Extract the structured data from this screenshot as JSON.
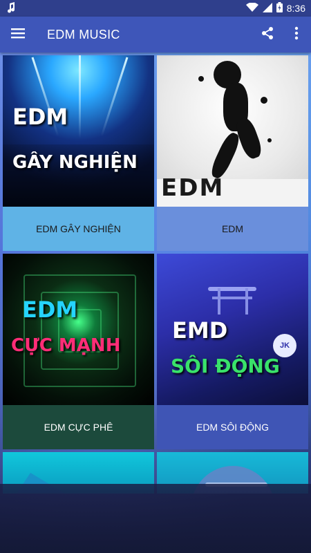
{
  "status": {
    "time": "8:36",
    "icons": [
      "music-note-icon",
      "wifi-icon",
      "signal-icon",
      "battery-icon"
    ]
  },
  "appbar": {
    "title": "EDM MUSIC",
    "bg_color": "#3e56b9",
    "actions": [
      "share-icon",
      "more-vert-icon"
    ]
  },
  "cards": [
    {
      "label": "EDM GÂY NGHIỆN",
      "art_line1": "EDM",
      "art_line2": "GÂY NGHIỆN",
      "label_bg": "#5fb3e6"
    },
    {
      "label": "EDM",
      "art_line1": "EDM",
      "label_bg": "#6a8fdc"
    },
    {
      "label": "EDM CỰC PHÊ",
      "art_line1": "EDM",
      "art_line2": "CỰC MẠNH",
      "label_bg": "#1c4a3c"
    },
    {
      "label": "EDM SÔI ĐỘNG",
      "art_line1": "EMD",
      "art_line2": "SÔI ĐỘNG",
      "art_badge": "JK",
      "label_bg": "#3f55b5"
    },
    {
      "label": ""
    },
    {
      "label": ""
    }
  ]
}
